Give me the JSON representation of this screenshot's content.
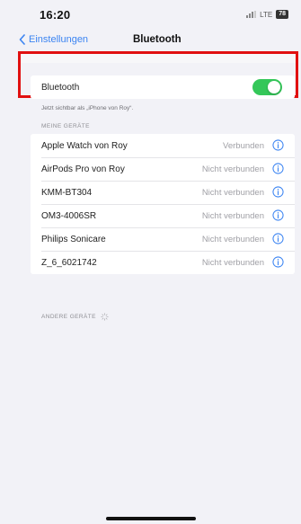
{
  "status_bar": {
    "time": "16:20",
    "network": "LTE",
    "battery": "78"
  },
  "nav": {
    "back_label": "Einstellungen",
    "title": "Bluetooth"
  },
  "bluetooth": {
    "label": "Bluetooth",
    "enabled": true,
    "caption": "Jetzt sichtbar als „iPhone von Roy“."
  },
  "my_devices": {
    "header": "MEINE GERÄTE",
    "items": [
      {
        "name": "Apple Watch von Roy",
        "status": "Verbunden"
      },
      {
        "name": "AirPods Pro von Roy",
        "status": "Nicht verbunden"
      },
      {
        "name": "KMM-BT304",
        "status": "Nicht verbunden"
      },
      {
        "name": "OM3-4006SR",
        "status": "Nicht verbunden"
      },
      {
        "name": "Philips Sonicare",
        "status": "Nicht verbunden"
      },
      {
        "name": "Z_6_6021742",
        "status": "Nicht verbunden"
      }
    ]
  },
  "other_devices": {
    "header": "ANDERE GERÄTE"
  },
  "colors": {
    "accent": "#3b84f2",
    "toggle_on": "#34c759",
    "highlight": "#e11010"
  },
  "icons": [
    "chevron-left-icon",
    "info-icon",
    "spinner-icon"
  ]
}
